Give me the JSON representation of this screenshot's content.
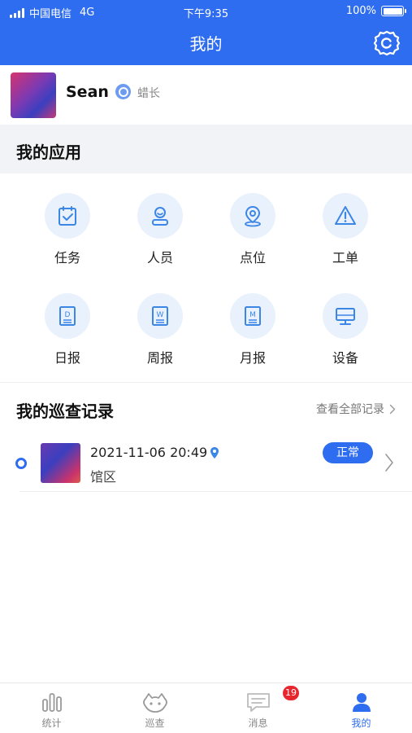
{
  "status_bar": {
    "carrier": "中国电信",
    "network": "4G",
    "time": "下午9:35",
    "battery": "100%"
  },
  "header": {
    "title": "我的"
  },
  "profile": {
    "name": "Sean",
    "role": "蜡长"
  },
  "apps": {
    "title": "我的应用",
    "items": [
      {
        "label": "任务",
        "icon": "task-icon"
      },
      {
        "label": "人员",
        "icon": "person-icon"
      },
      {
        "label": "点位",
        "icon": "location-icon"
      },
      {
        "label": "工单",
        "icon": "warning-icon"
      },
      {
        "label": "日报",
        "icon": "daily-report-icon"
      },
      {
        "label": "周报",
        "icon": "weekly-report-icon"
      },
      {
        "label": "月报",
        "icon": "monthly-report-icon"
      },
      {
        "label": "设备",
        "icon": "device-icon"
      }
    ],
    "report_letters": {
      "daily": "D",
      "weekly": "W",
      "monthly": "M"
    }
  },
  "records": {
    "title": "我的巡查记录",
    "view_all": "查看全部记录",
    "items": [
      {
        "datetime": "2021-11-06 20:49",
        "area": "馆区",
        "status": "正常"
      }
    ]
  },
  "tabbar": {
    "items": [
      {
        "label": "统计",
        "icon": "stats-icon",
        "active": false
      },
      {
        "label": "巡查",
        "icon": "patrol-icon",
        "active": false
      },
      {
        "label": "消息",
        "icon": "message-icon",
        "active": false,
        "badge": "19"
      },
      {
        "label": "我的",
        "icon": "profile-icon",
        "active": true
      }
    ]
  },
  "colors": {
    "primary": "#2f6df0",
    "icon_bg": "#e9f1fc",
    "badge_red": "#e8262d"
  }
}
